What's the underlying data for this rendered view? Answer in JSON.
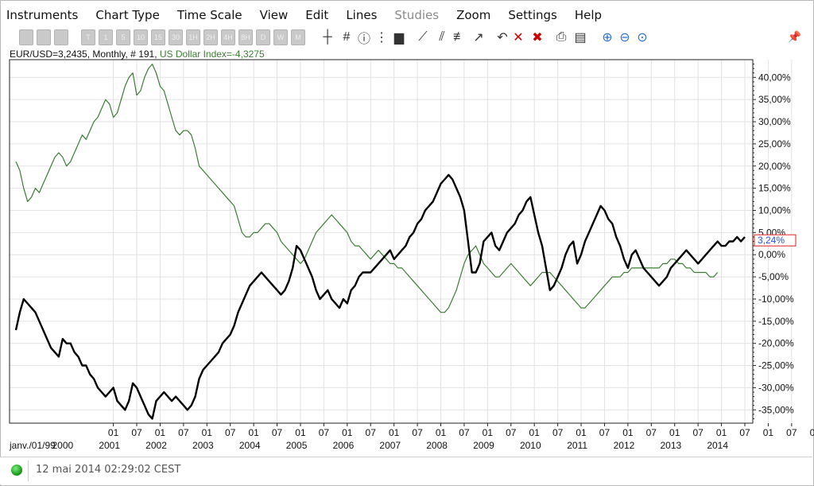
{
  "menu": [
    "Instruments",
    "Chart Type",
    "Time Scale",
    "View",
    "Edit",
    "Lines",
    "Studies",
    "Zoom",
    "Settings",
    "Help"
  ],
  "menu_disabled": [
    "Studies"
  ],
  "toolbar": {
    "disabled_buttons": [
      "T",
      "1",
      "5",
      "10",
      "15",
      "30",
      "1H",
      "2H",
      "4H",
      "8H",
      "D",
      "W",
      "M"
    ],
    "icons": [
      "crosshair-icon",
      "grid-icon",
      "info-icon",
      "data-icon",
      "bars-icon",
      "line-tool-icon",
      "channel-tool-icon",
      "fib-tool-icon",
      "arrow-tool-icon",
      "undo-icon",
      "delete-icon",
      "delete-all-icon",
      "print-icon",
      "print-preview-icon",
      "zoom-in-icon",
      "zoom-out-icon",
      "zoom-reset-icon",
      "pin-icon"
    ],
    "accent": "#2a6fdb",
    "delete_color": "#cc0000"
  },
  "info": {
    "primary": "EUR/USD=3,2435, Monthly, # 191,",
    "secondary": "US Dollar Index=-4,3275"
  },
  "status": {
    "timestamp": "12 mai 2014 02:29:02 CEST",
    "connection_color": "#22aa22"
  },
  "chart_data": {
    "type": "line",
    "ylim": [
      -38,
      44
    ],
    "y_ticks": [
      "40,00%",
      "35,00%",
      "30,00%",
      "25,00%",
      "20,00%",
      "15,00%",
      "10,00%",
      "5,00%",
      "0,00%",
      "-5,00%",
      "-10,00%",
      "-15,00%",
      "-20,00%",
      "-25,00%",
      "-30,00%",
      "-35,00%"
    ],
    "y_tick_values": [
      40,
      35,
      30,
      25,
      20,
      15,
      10,
      5,
      0,
      -5,
      -10,
      -15,
      -20,
      -25,
      -30,
      -35
    ],
    "current_label": "3,24%",
    "current_value": 3.24,
    "x_start": "1999-01",
    "month_labels": [
      "01",
      "07",
      "01",
      "07",
      "01",
      "07",
      "01",
      "07",
      "01",
      "07",
      "01",
      "07",
      "01",
      "07",
      "01",
      "07",
      "01",
      "07",
      "01",
      "07",
      "01",
      "07",
      "01",
      "07",
      "01",
      "07",
      "01",
      "07",
      "01",
      "07",
      "01",
      "07"
    ],
    "month_label_months": [
      25,
      31,
      37,
      43,
      49,
      55,
      61,
      67,
      73,
      79,
      85,
      91,
      97,
      103,
      109,
      115,
      121,
      127,
      133,
      139,
      145,
      151,
      157,
      163,
      169,
      175,
      181,
      187,
      193,
      199,
      205,
      211
    ],
    "year_labels": [
      "janv./01/99",
      "2000",
      "2001",
      "2002",
      "2003",
      "2004",
      "2005",
      "2006",
      "2007",
      "2008",
      "2009",
      "2010",
      "2011",
      "2012",
      "2013",
      "2014"
    ],
    "year_label_months": [
      0,
      12,
      24,
      36,
      48,
      60,
      72,
      84,
      96,
      108,
      120,
      132,
      144,
      156,
      168,
      180
    ],
    "series": [
      {
        "name": "EUR/USD",
        "color": "#000000",
        "values": [
          -17,
          -13,
          -10,
          -11,
          -12,
          -13,
          -15,
          -17,
          -19,
          -21,
          -22,
          -23,
          -19,
          -20,
          -20,
          -22,
          -23,
          -25,
          -25,
          -27,
          -28,
          -30,
          -31,
          -32,
          -31,
          -30,
          -33,
          -34,
          -35,
          -33,
          -29,
          -30,
          -32,
          -34,
          -36,
          -37,
          -33,
          -32,
          -31,
          -32,
          -33,
          -32,
          -33,
          -34,
          -35,
          -34,
          -32,
          -28,
          -26,
          -25,
          -24,
          -23,
          -22,
          -20,
          -19,
          -18,
          -16,
          -13,
          -11,
          -9,
          -7,
          -6,
          -5,
          -4,
          -5,
          -6,
          -7,
          -8,
          -9,
          -8,
          -6,
          -3,
          2,
          1,
          -1,
          -3,
          -5,
          -8,
          -10,
          -9,
          -8,
          -10,
          -11,
          -12,
          -10,
          -11,
          -8,
          -7,
          -5,
          -4,
          -4,
          -4,
          -3,
          -2,
          -1,
          0,
          1,
          -1,
          0,
          1,
          2,
          4,
          5,
          7,
          8,
          10,
          11,
          12,
          14,
          16,
          17,
          18,
          17,
          15,
          13,
          10,
          3,
          -4,
          -4,
          -2,
          3,
          4,
          5,
          2,
          1,
          3,
          5,
          6,
          7,
          9,
          10,
          12,
          13,
          9,
          5,
          2,
          -3,
          -8,
          -7,
          -5,
          -3,
          0,
          2,
          3,
          -2,
          0,
          3,
          5,
          7,
          9,
          11,
          10,
          8,
          7,
          4,
          2,
          -1,
          -3,
          0,
          1,
          -1,
          -3,
          -4,
          -5,
          -6,
          -7,
          -6,
          -5,
          -3,
          -2,
          -1,
          0,
          1,
          0,
          -1,
          -2,
          -1,
          0,
          1,
          2,
          3,
          2,
          2,
          3,
          3,
          4,
          3,
          4
        ]
      },
      {
        "name": "US Dollar Index",
        "color": "#3a7d32",
        "values": [
          21,
          19,
          15,
          12,
          13,
          15,
          14,
          16,
          18,
          20,
          22,
          23,
          22,
          20,
          21,
          23,
          25,
          27,
          26,
          28,
          30,
          31,
          33,
          35,
          34,
          31,
          32,
          35,
          38,
          40,
          41,
          36,
          37,
          40,
          42,
          43,
          41,
          38,
          37,
          34,
          31,
          28,
          27,
          28,
          28,
          27,
          24,
          20,
          19,
          18,
          17,
          16,
          15,
          14,
          13,
          12,
          11,
          8,
          5,
          4,
          4,
          5,
          5,
          6,
          7,
          7,
          6,
          5,
          3,
          2,
          1,
          0,
          -1,
          -2,
          -1,
          1,
          3,
          5,
          6,
          7,
          8,
          9,
          8,
          7,
          6,
          5,
          3,
          2,
          2,
          1,
          0,
          -1,
          0,
          1,
          0,
          -1,
          -2,
          -2,
          -3,
          -3,
          -4,
          -5,
          -6,
          -7,
          -8,
          -9,
          -10,
          -11,
          -12,
          -13,
          -13,
          -12,
          -10,
          -8,
          -5,
          -2,
          0,
          1,
          2,
          0,
          -2,
          -3,
          -4,
          -5,
          -5,
          -4,
          -3,
          -2,
          -3,
          -4,
          -5,
          -6,
          -7,
          -6,
          -5,
          -4,
          -4,
          -4,
          -5,
          -6,
          -7,
          -8,
          -9,
          -10,
          -11,
          -12,
          -12,
          -11,
          -10,
          -9,
          -8,
          -7,
          -6,
          -5,
          -5,
          -5,
          -4,
          -4,
          -3,
          -3,
          -3,
          -3,
          -3,
          -3,
          -3,
          -3,
          -2,
          -2,
          -1,
          -1,
          -2,
          -2,
          -3,
          -3,
          -4,
          -4,
          -4,
          -4,
          -5,
          -5,
          -4
        ]
      }
    ]
  }
}
